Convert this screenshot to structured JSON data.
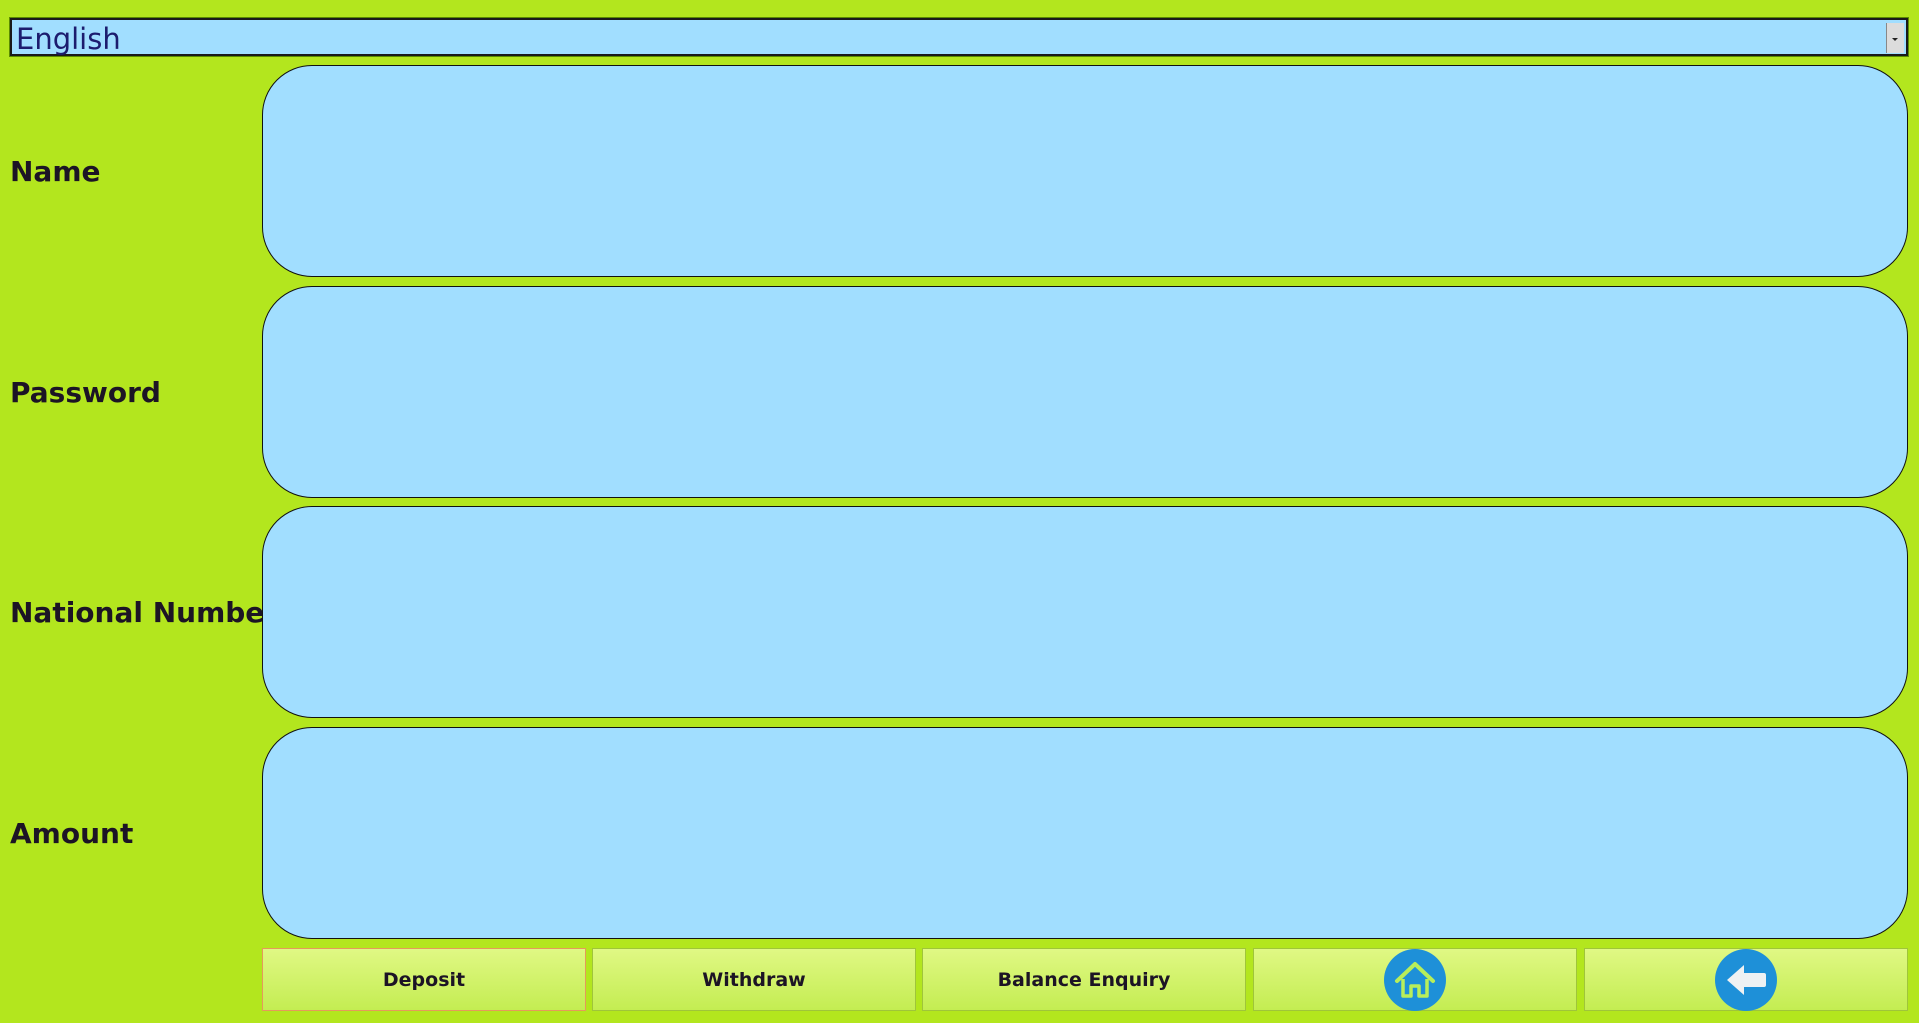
{
  "language_select": {
    "value": "English"
  },
  "form": {
    "fields": [
      {
        "label": "Name",
        "value": ""
      },
      {
        "label": "Password",
        "value": ""
      },
      {
        "label": "National Number",
        "value": ""
      },
      {
        "label": "Amount",
        "value": ""
      }
    ]
  },
  "actions": {
    "deposit_label": "Deposit",
    "withdraw_label": "Withdraw",
    "balance_label": "Balance Enquiry",
    "home_icon": "home-icon",
    "back_icon": "back-arrow-icon"
  },
  "colors": {
    "background": "#b3e61e",
    "field_fill": "#a1deff",
    "icon_circle": "#1e90d8"
  }
}
